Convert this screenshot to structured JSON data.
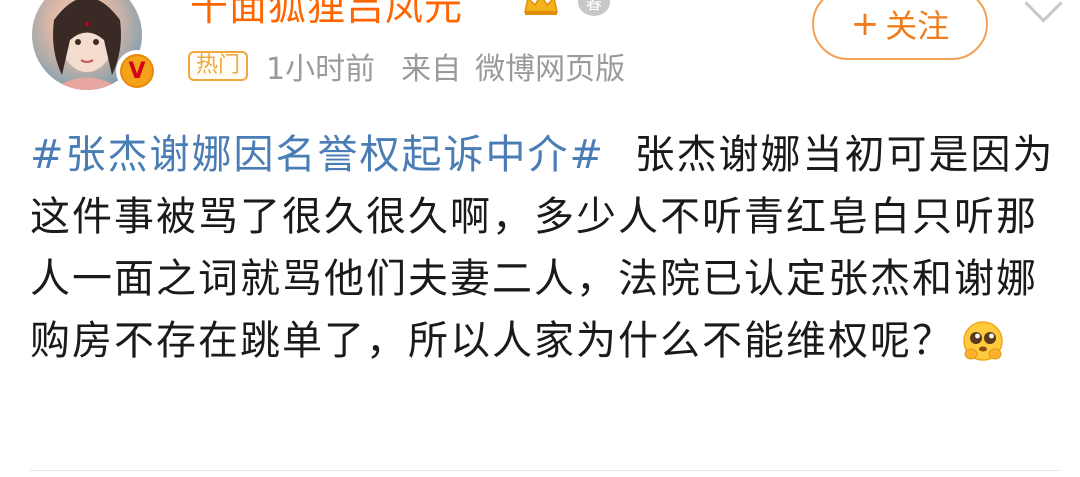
{
  "user": {
    "name": "千面狐狸吕凤元",
    "verified_mark": "V",
    "level": "春"
  },
  "meta": {
    "hot_tag": "热门",
    "time": "1小时前",
    "source_prefix": "来自",
    "source": "微博网页版"
  },
  "follow_button": {
    "plus": "+",
    "label": "关注"
  },
  "post": {
    "hashtag": "#张杰谢娜因名誉权起诉中介#",
    "text": "张杰谢娜当初可是因为这件事被骂了很久很久啊，多少人不听青红皂白只听那人一面之词就骂他们夫妻二人，法院已认定张杰和谢娜购房不存在跳单了，所以人家为什么不能维权呢？",
    "emoji": "pleading-face-emoji"
  },
  "colors": {
    "username": "#ff6600",
    "hashtag": "#4a7db5",
    "follow": "#f07c1c",
    "hot_tag": "#f0a73b",
    "meta_text": "#9a9a9a"
  }
}
